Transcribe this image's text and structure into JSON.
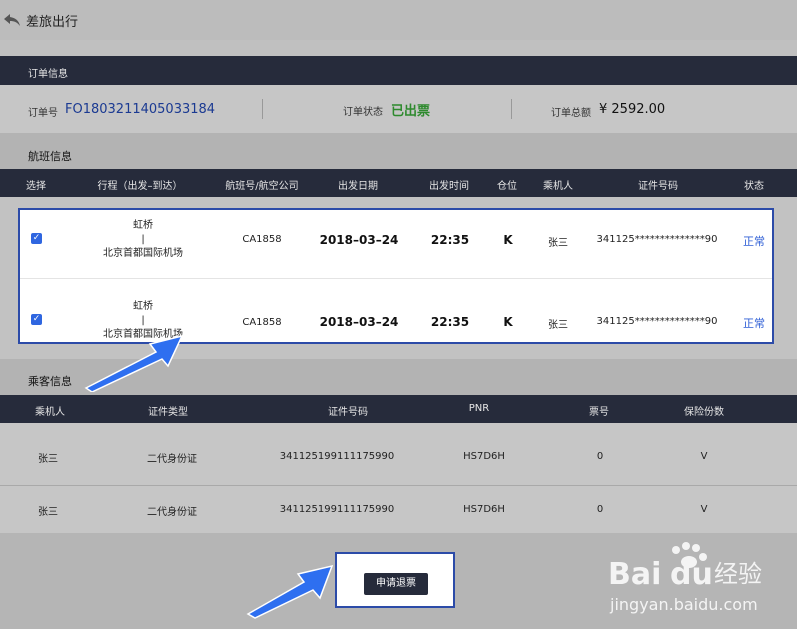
{
  "header": {
    "title": "差旅出行",
    "back_icon": "back-arrow-icon"
  },
  "order": {
    "section_label": "订单信息",
    "number_label": "订单号",
    "number": "FO1803211405033184",
    "status_label": "订单状态",
    "status": "已出票",
    "total_label": "订单总额",
    "total": "¥ 2592.00"
  },
  "flights": {
    "section_title": "航班信息",
    "columns": [
      "选择",
      "行程（出发–到达）",
      "航班号/航空公司",
      "出发日期",
      "出发时间",
      "仓位",
      "乘机人",
      "证件号码",
      "状态"
    ],
    "rows": [
      {
        "from": "虹桥",
        "separator": "|",
        "to": "北京首都国际机场",
        "flight_no": "CA1858",
        "date": "2018–03–24",
        "time": "22:35",
        "cabin": "K",
        "passenger": "张三",
        "id_no": "341125**************90",
        "status": "正常",
        "checked": true
      },
      {
        "from": "虹桥",
        "separator": "|",
        "to": "北京首都国际机场",
        "flight_no": "CA1858",
        "date": "2018–03–24",
        "time": "22:35",
        "cabin": "K",
        "passenger": "张三",
        "id_no": "341125**************90",
        "status": "正常",
        "checked": true
      }
    ]
  },
  "passengers": {
    "section_title": "乘客信息",
    "columns": [
      "乘机人",
      "证件类型",
      "证件号码",
      "PNR",
      "票号",
      "保险份数"
    ],
    "rows": [
      {
        "name": "张三",
        "id_type": "二代身份证",
        "id_no": "341125199111175990",
        "pnr": "HS7D6H",
        "ticket": "0",
        "insurance": "V"
      },
      {
        "name": "张三",
        "id_type": "二代身份证",
        "id_no": "341125199111175990",
        "pnr": "HS7D6H",
        "ticket": "0",
        "insurance": "V"
      }
    ]
  },
  "actions": {
    "refund_label": "申请退票"
  },
  "watermark": {
    "brand_left": "Bai",
    "brand_right": "du",
    "brand_cn": "经验",
    "url": "jingyan.baidu.com"
  },
  "colors": {
    "header_dark": "#262b3b",
    "accent_blue": "#2c4ba8",
    "status_green": "#2e8a2e",
    "link_blue": "#2f5fd6"
  }
}
